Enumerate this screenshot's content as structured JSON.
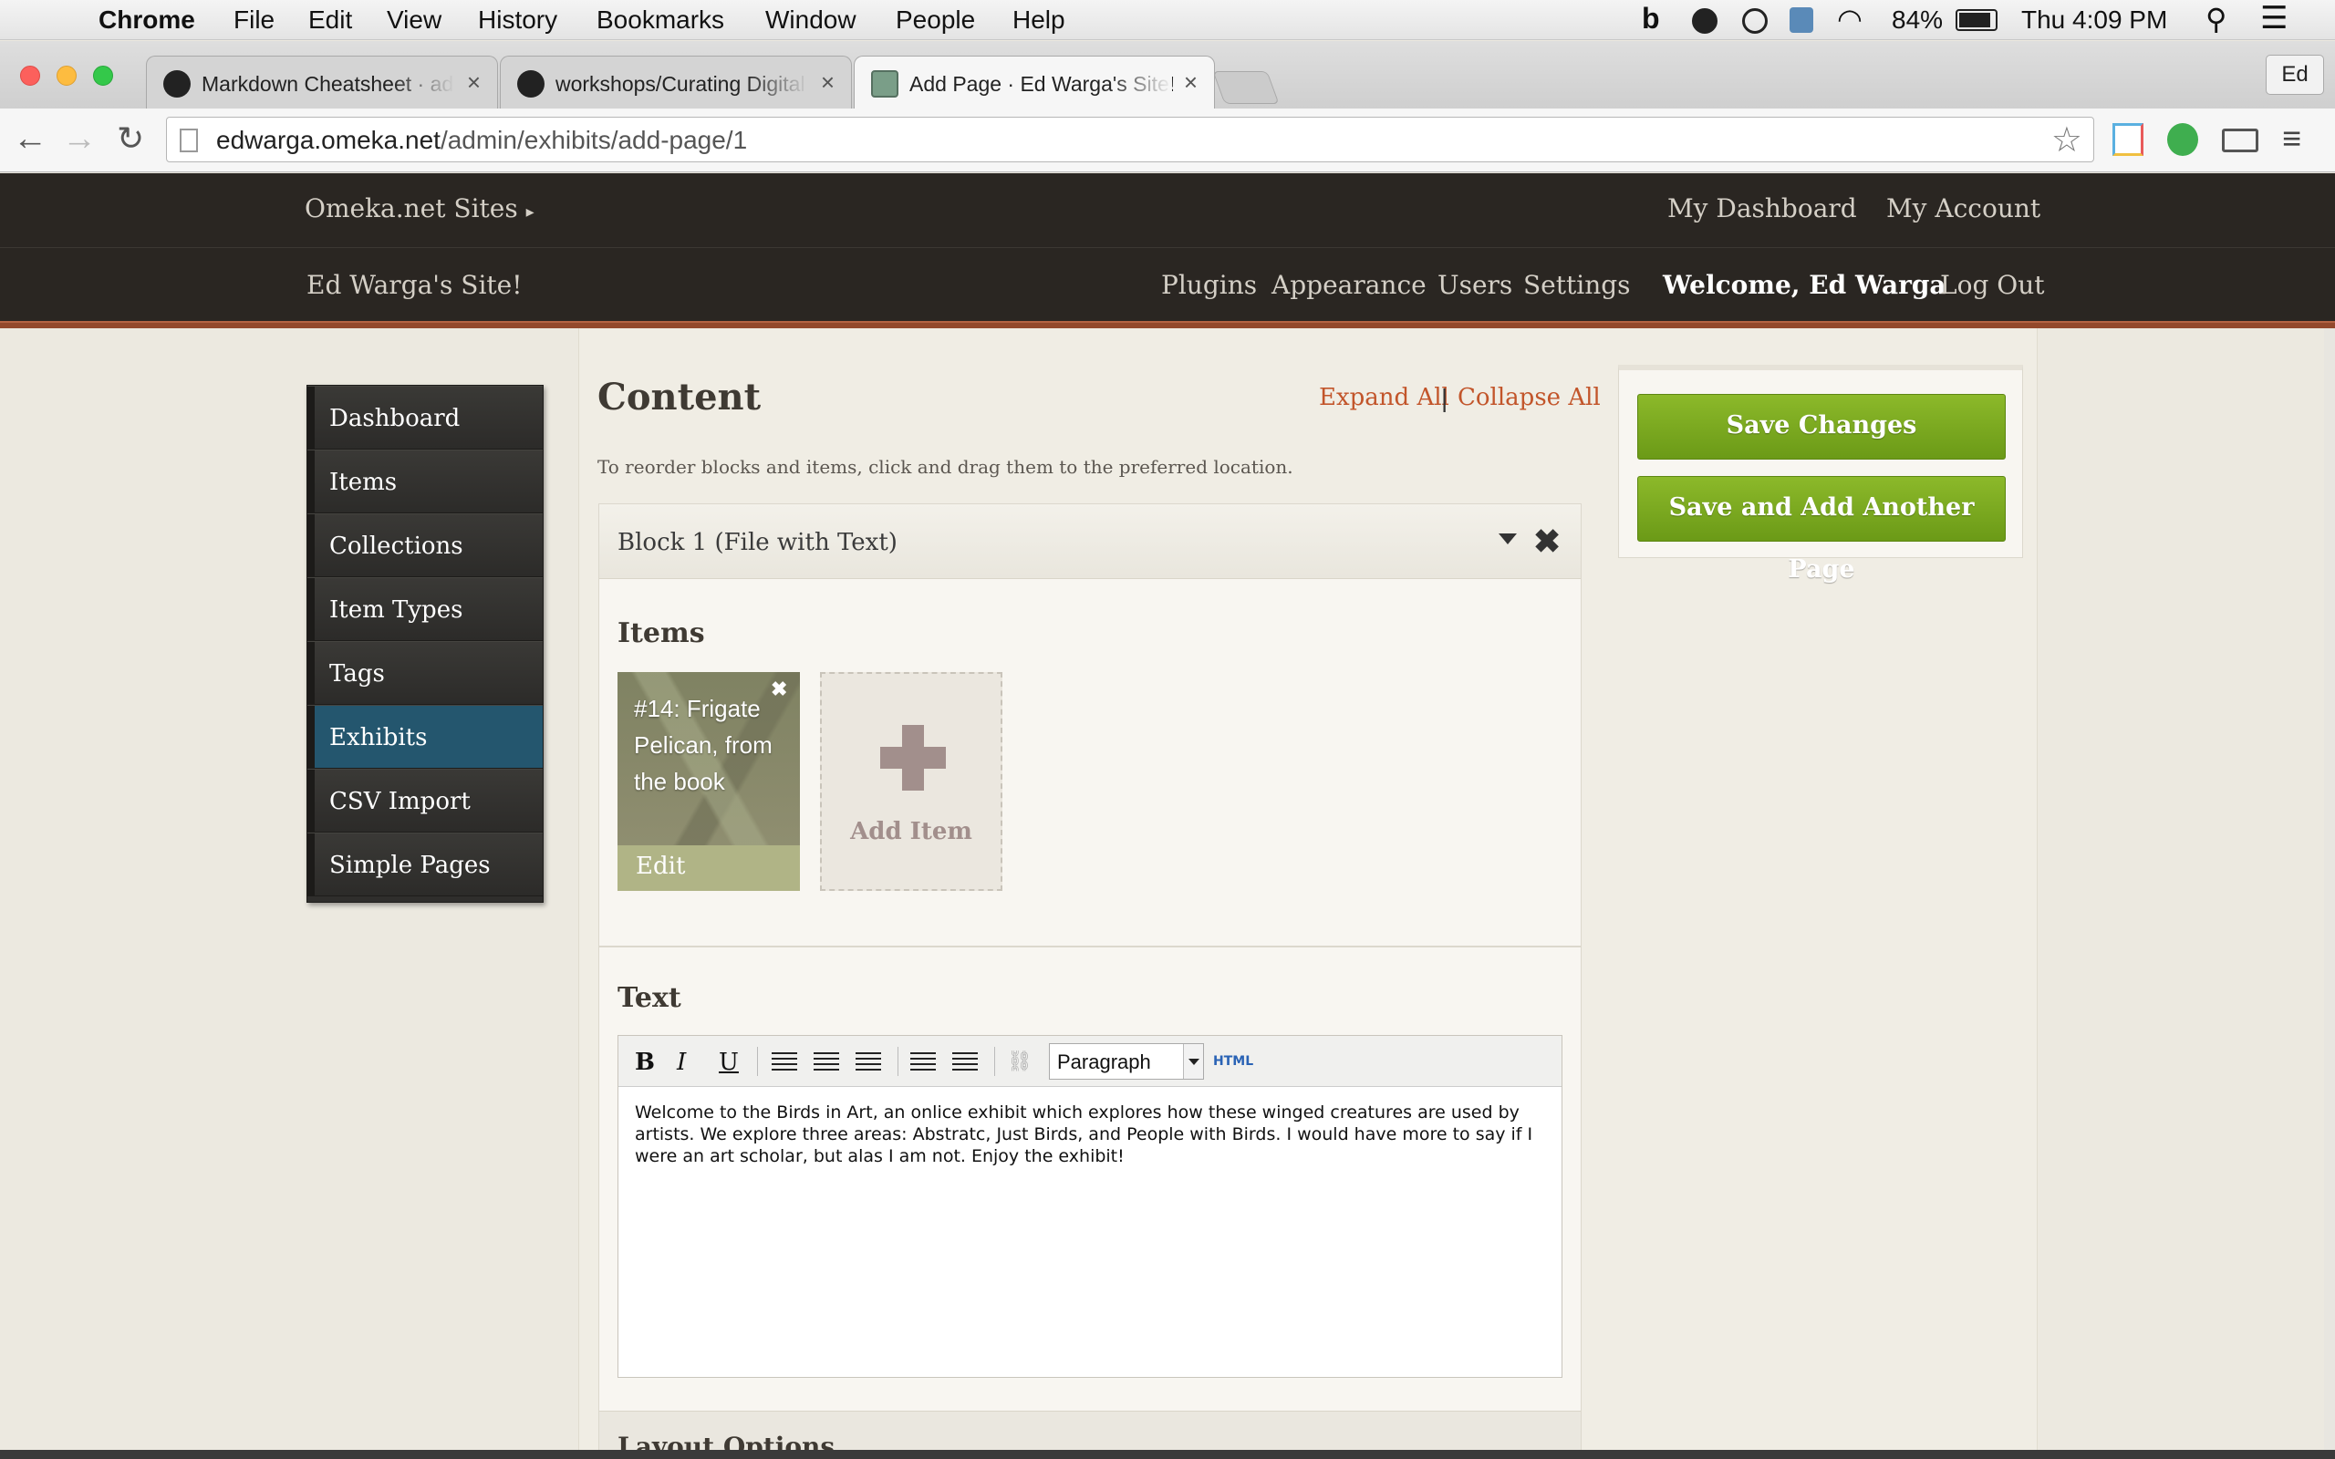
{
  "menubar": {
    "app": "Chrome",
    "items": [
      "File",
      "Edit",
      "View",
      "History",
      "Bookmarks",
      "Window",
      "People",
      "Help"
    ],
    "battery": "84%",
    "clock": "Thu 4:09 PM"
  },
  "tabs": [
    {
      "title": "Markdown Cheatsheet · ad"
    },
    {
      "title": "workshops/Curating Digital"
    },
    {
      "title": "Add Page · Ed Warga's Site!"
    }
  ],
  "profile": "Ed",
  "url": {
    "host": "edwarga.omeka.net",
    "path": "/admin/exhibits/add-page/1"
  },
  "header": {
    "sites": "Omeka.net Sites",
    "my_dashboard": "My Dashboard",
    "my_account": "My Account",
    "site_name": "Ed Warga's Site!",
    "nav": [
      "Plugins",
      "Appearance",
      "Users",
      "Settings"
    ],
    "welcome": "Welcome, Ed Warga",
    "logout": "Log Out"
  },
  "sidebar": {
    "items": [
      {
        "label": "Dashboard"
      },
      {
        "label": "Items"
      },
      {
        "label": "Collections"
      },
      {
        "label": "Item Types"
      },
      {
        "label": "Tags"
      },
      {
        "label": "Exhibits"
      },
      {
        "label": "CSV Import"
      },
      {
        "label": "Simple Pages"
      }
    ],
    "selected": "Exhibits"
  },
  "content": {
    "title": "Content",
    "expand_all": "Expand All",
    "separator": "|",
    "collapse_all": "Collapse All",
    "help": "To reorder blocks and items, click and drag them to the preferred location."
  },
  "block": {
    "title": "Block 1 (File with Text)",
    "items_heading": "Items",
    "item": {
      "title": "#14: Frigate Pelican, from the book",
      "edit": "Edit",
      "remove": "✖"
    },
    "add_item": "Add Item",
    "text_heading": "Text",
    "editor": {
      "format": "Paragraph",
      "html_label": "HTML",
      "body": "Welcome to the Birds in Art, an onlice exhibit which explores how these winged creatures are used by artists. We explore three areas: Abstratc, Just Birds, and People with Birds. I would have more to say if I were an art scholar, but alas I am not. Enjoy the exhibit!"
    },
    "layout_options": "Layout Options"
  },
  "actions": {
    "save": "Save Changes",
    "save_add": "Save and Add Another Page"
  }
}
